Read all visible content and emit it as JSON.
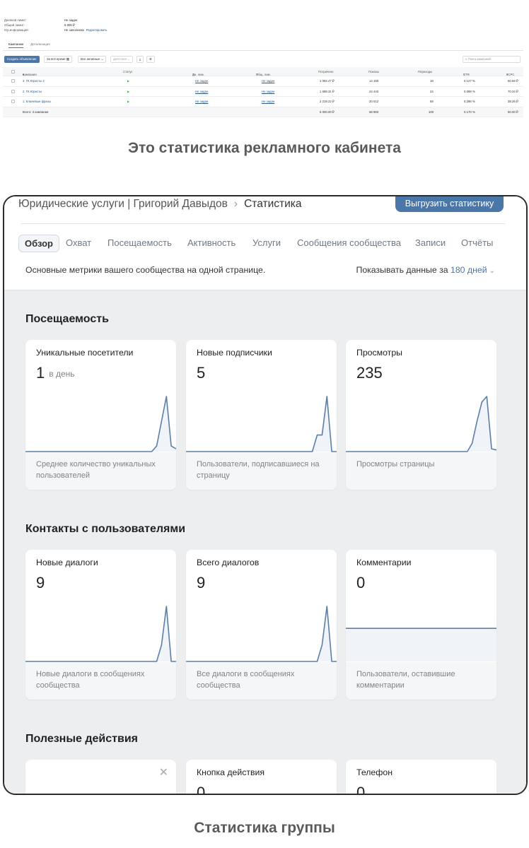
{
  "ads_cabinet": {
    "meta": [
      {
        "key": "Дневной лимит:",
        "value": "Не задан"
      },
      {
        "key": "Общий лимит:",
        "value": "5 000 ₽"
      },
      {
        "key": "Юр.информация:",
        "value": "Не заполнена",
        "link": "Редактировать"
      }
    ],
    "tabs": [
      "Кампании",
      "Детализация"
    ],
    "toolbar": {
      "create": "Создать объявление",
      "period": "За всё время",
      "filter": "Все активные",
      "actions": "Действия",
      "search_placeholder": "Поиск кампаний"
    },
    "columns": [
      "Кампания",
      "Статус",
      "Дн. лим.",
      "Общ. лим.",
      "Потрачено",
      "Показы",
      "Переходы",
      "CTR",
      "eCPC"
    ],
    "rows": [
      {
        "name": "3. ГК Юристы 2",
        "day_limit": "Не задан",
        "total_limit": "Не задан",
        "spent": "1 092.47 ₽",
        "shows": "14 150",
        "clicks": "18",
        "ctr": "0.127 %",
        "ecpc": "60.69 ₽"
      },
      {
        "name": "2. ГК Юристы",
        "day_limit": "Не задан",
        "total_limit": "Не задан",
        "spent": "1 688.31 ₽",
        "shows": "24 443",
        "clicks": "24",
        "ctr": "0.098 %",
        "ecpc": "70.34 ₽"
      },
      {
        "name": "1. Ключевые фразы",
        "day_limit": "Не задан",
        "total_limit": "Не задан",
        "spent": "2 219.22 ₽",
        "shows": "20 512",
        "clicks": "58",
        "ctr": "0.286 %",
        "ecpc": "38.26 ₽"
      }
    ],
    "total": {
      "name": "Всего: 3 кампании",
      "spent": "5 000.00 ₽",
      "shows": "58 883",
      "clicks": "100",
      "ctr": "0.170 %",
      "ecpc": "50.00 ₽"
    }
  },
  "caption_top": "Это статистика рекламного кабинета",
  "caption_bottom": "Статистика группы",
  "stats": {
    "breadcrumb": {
      "group": "Юридические услуги | Григорий Давыдов",
      "separator": "›",
      "current": "Статистика"
    },
    "export_button": "Выгрузить статистику",
    "tabs": [
      "Обзор",
      "Охват",
      "Посещаемость",
      "Активность",
      "Услуги",
      "Сообщения сообщества",
      "Записи",
      "Отчёты"
    ],
    "subtitle": "Основные метрики вашего сообщества на одной странице.",
    "period_label": "Показывать данные за",
    "period_value": "180 дней",
    "sections": [
      {
        "title": "Посещаемость",
        "cards": [
          {
            "title": "Уникальные посетители",
            "value": "1",
            "unit": "в день",
            "footer": "Среднее количество уникальных пользователей",
            "spark": [
              0,
              0,
              0,
              0,
              0,
              0,
              0,
              0,
              0,
              0,
              0,
              0,
              0,
              0,
              0,
              0,
              0,
              0,
              0,
              0,
              0,
              0,
              0,
              0,
              0,
              0,
              0,
              0.1,
              0.55,
              1,
              0.1,
              0.05
            ]
          },
          {
            "title": "Новые подписчики",
            "value": "5",
            "unit": "",
            "footer": "Пользователи, подписавшиеся на страницу",
            "spark": [
              0,
              0,
              0,
              0,
              0,
              0,
              0,
              0,
              0,
              0,
              0,
              0,
              0,
              0,
              0,
              0,
              0,
              0,
              0,
              0,
              0,
              0,
              0,
              0,
              0,
              0,
              0,
              0.3,
              0.3,
              1,
              0,
              0
            ]
          },
          {
            "title": "Просмотры",
            "value": "235",
            "unit": "",
            "footer": "Просмотры страницы",
            "spark": [
              0,
              0,
              0,
              0,
              0,
              0,
              0,
              0,
              0,
              0,
              0,
              0,
              0,
              0,
              0,
              0,
              0,
              0,
              0,
              0,
              0,
              0,
              0,
              0,
              0,
              0,
              0.15,
              0.55,
              0.9,
              1,
              0.05,
              0.03
            ]
          }
        ]
      },
      {
        "title": "Контакты с пользователями",
        "cards": [
          {
            "title": "Новые диалоги",
            "value": "9",
            "unit": "",
            "footer": "Новые диалоги в сообщениях сообщества",
            "spark": [
              0,
              0,
              0,
              0,
              0,
              0,
              0,
              0,
              0,
              0,
              0,
              0,
              0,
              0,
              0,
              0,
              0,
              0,
              0,
              0,
              0,
              0,
              0,
              0,
              0,
              0,
              0,
              0,
              0.3,
              1,
              0,
              0
            ]
          },
          {
            "title": "Всего диалогов",
            "value": "9",
            "unit": "",
            "footer": "Все диалоги в сообщениях сообщества",
            "spark": [
              0,
              0,
              0,
              0,
              0,
              0,
              0,
              0,
              0,
              0,
              0,
              0,
              0,
              0,
              0,
              0,
              0,
              0,
              0,
              0,
              0,
              0,
              0,
              0,
              0,
              0,
              0,
              0,
              0.3,
              1,
              0,
              0
            ]
          },
          {
            "title": "Комментарии",
            "value": "0",
            "unit": "",
            "footer": "Пользователи, оставившие комментарии",
            "spark": [
              0.6,
              0.6,
              0.6,
              0.6,
              0.6,
              0.6,
              0.6,
              0.6,
              0.6,
              0.6,
              0.6,
              0.6,
              0.6,
              0.6,
              0.6,
              0.6,
              0.6,
              0.6,
              0.6,
              0.6,
              0.6,
              0.6,
              0.6,
              0.6,
              0.6,
              0.6,
              0.6,
              0.6,
              0.6,
              0.6,
              0.6,
              0.6
            ]
          }
        ]
      },
      {
        "title": "Полезные действия",
        "cards": [
          {
            "title": "",
            "value": "",
            "unit": "",
            "footer": "",
            "closable": true
          },
          {
            "title": "Кнопка действия",
            "value": "0",
            "unit": "",
            "footer": ""
          },
          {
            "title": "Телефон",
            "value": "0",
            "unit": "",
            "footer": ""
          }
        ]
      }
    ]
  },
  "colors": {
    "accent": "#4a76a8",
    "spark_line": "#5b7fa8",
    "body_bg": "#edeef0"
  }
}
